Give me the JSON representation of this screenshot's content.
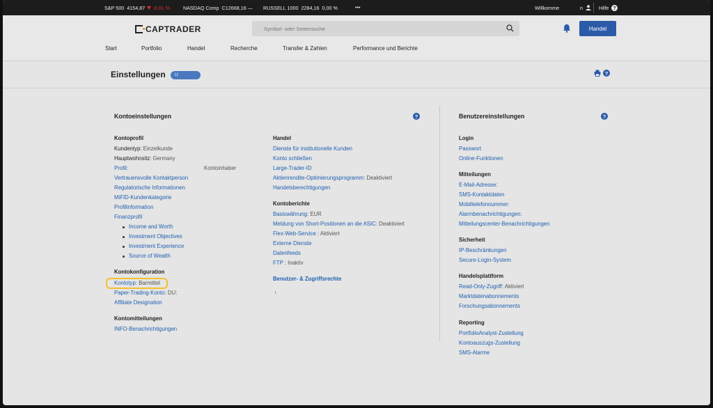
{
  "ticker": {
    "sp_label": "S&P 500",
    "sp_value": "4154,87",
    "sp_change": "-0,01 %",
    "nasdaq_label": "NASDAQ Comp",
    "nasdaq_value": "C12668,16",
    "nasdaq_change": "—",
    "russell_label": "RUSSELL 1000",
    "russell_value": "2284,16",
    "russell_change": "0,00 %",
    "more": "•••",
    "welcome": "Willkomme",
    "user": "n",
    "help": "Hilfe"
  },
  "header": {
    "logo": "CAPTRADER",
    "search_placeholder": "Symbol- oder Seitensuche",
    "trade_button": "Handel",
    "nav": [
      "Start",
      "Portfolio",
      "Handel",
      "Recherche",
      "Transfer & Zahlen",
      "Performance und Berichte"
    ]
  },
  "page": {
    "title": "Einstellungen",
    "account_pill": "U"
  },
  "konto": {
    "title": "Kontoeinstellungen",
    "profil": {
      "heading": "Kontoprofil",
      "kundentyp_label": "Kundentyp:",
      "kundentyp_value": "Einzelkunde",
      "wohnsitz_label": "Hauptwohnsitz:",
      "wohnsitz_value": "Germany",
      "profil_link": "Profil:",
      "profil_value": "Kontoinhaber",
      "links": [
        "Vertrauensvolle Kontaktperson",
        "Regulatorische Informationen",
        "MiFID-Kundenkategorie",
        "Profilinformation",
        "Finanzprofil"
      ],
      "finanzprofil_items": [
        "Income and Worth",
        "Investment Objectives",
        "Investment Experience",
        "Source of Wealth"
      ]
    },
    "konfig": {
      "heading": "Kontokonfiguration",
      "kontotyp_link": "Kontotyp:",
      "kontotyp_value": "Barmittel",
      "paper_link": "Paper-Trading-Konto:",
      "paper_value": "DU:",
      "affiliate": "Affiliate Designation"
    },
    "mitteilungen": {
      "heading": "Kontomitteilungen",
      "info": "INFO-Benachrichtigungen"
    },
    "handel": {
      "heading": "Handel",
      "links": [
        "Dienste für institutionelle Kunden",
        "Konto schließen",
        "Large-Trader-ID"
      ],
      "aktien_link": "Aktienrendite-Optimierungsprogramm:",
      "aktien_value": "Deaktiviert",
      "berechtigungen": "Handelsberechtigungen"
    },
    "berichte": {
      "heading": "Kontoberichte",
      "basis_link": "Basiswährung:",
      "basis_value": "EUR",
      "short_link": "Meldung von Short-Positionen an die ASIC:",
      "short_value": "Deaktiviert",
      "flex_link": "Flex-Web-Service :",
      "flex_value": "Aktiviert",
      "externe": "Externe Dienste",
      "datenfeeds": "Datenfeeds",
      "ftp_link": "FTP :",
      "ftp_value": "Inaktiv"
    },
    "benutzer_rechte": "Benutzer- & Zugriffsrechte",
    "tiny": "ı"
  },
  "benutzer": {
    "title": "Benutzereinstellungen",
    "login": {
      "heading": "Login",
      "links": [
        "Passwort",
        "Online-Funktionen"
      ]
    },
    "mitteilungen": {
      "heading": "Mitteilungen",
      "links": [
        "E-Mail-Adresse:",
        "SMS-Kontaktdaten",
        "Mobiltelefonnummer:",
        "Alarmbenachrichtigungen:",
        "Mitteilungscenter-Benachrichtigungen"
      ]
    },
    "sicherheit": {
      "heading": "Sicherheit",
      "links": [
        "IP-Beschränkungen",
        "Secure-Login-System"
      ]
    },
    "plattform": {
      "heading": "Handelsplattform",
      "readonly_link": "Read-Only-Zugriff:",
      "readonly_value": "Aktiviert",
      "links": [
        "Marktdatenabonnements",
        "Forschungsabonnements"
      ]
    },
    "reporting": {
      "heading": "Reporting",
      "links": [
        "PortfolioAnalyst-Zustellung",
        "Kontoauszugs-Zustellung",
        "SMS-Alarme"
      ]
    }
  }
}
